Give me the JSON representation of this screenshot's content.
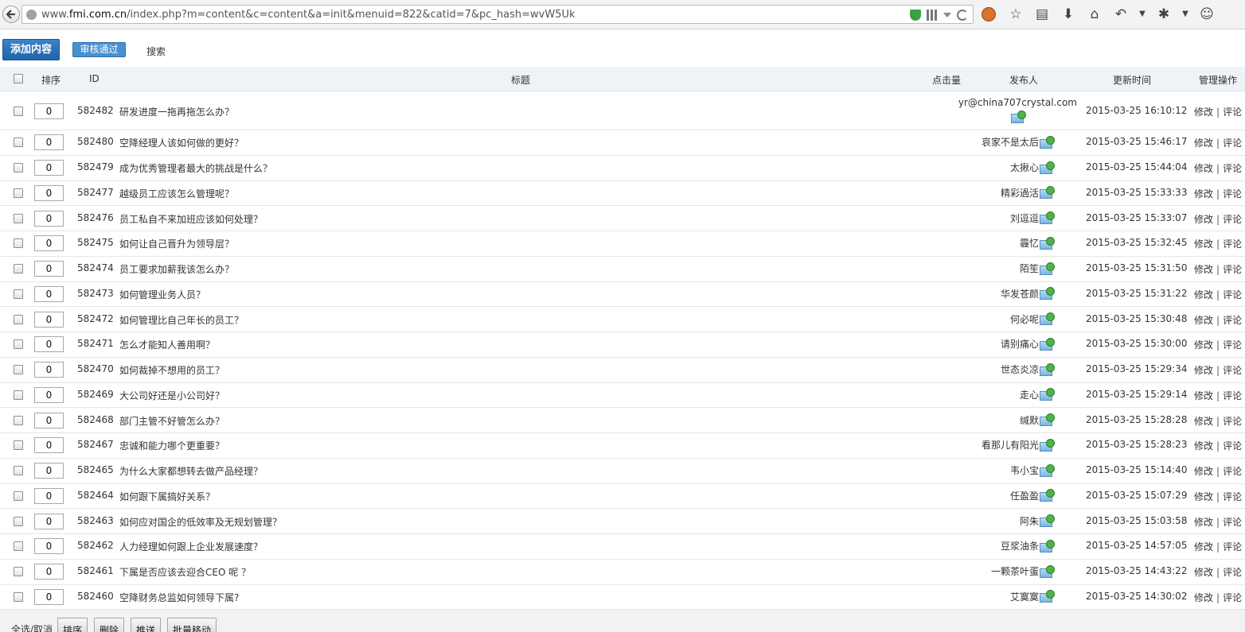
{
  "browser": {
    "url_prefix": "www.",
    "url_domain": "fmi.com.cn",
    "url_path": "/index.php?m=content&c=content&a=init&menuid=822&catid=7&pc_hash=wvW5Uk"
  },
  "toolbar": {
    "add_label": "添加内容",
    "approve_label": "审核通过",
    "search_label": "搜索"
  },
  "table": {
    "headers": {
      "sort": "排序",
      "id": "ID",
      "title": "标题",
      "clicks": "点击量",
      "publisher": "发布人",
      "updated": "更新时间",
      "ops": "管理操作"
    },
    "rows": [
      {
        "sort": "0",
        "id": "582482",
        "title": "研发进度一拖再拖怎么办？",
        "publisher": "yr@china707crystal.com",
        "time": "2015-03-25 16:10:12",
        "edit": "修改",
        "comment": "评论"
      },
      {
        "sort": "0",
        "id": "582480",
        "title": "空降经理人该如何做的更好？",
        "publisher": "哀家不是太后",
        "time": "2015-03-25 15:46:17",
        "edit": "修改",
        "comment": "评论"
      },
      {
        "sort": "0",
        "id": "582479",
        "title": "成为优秀管理者最大的挑战是什么？",
        "publisher": "太揪心",
        "time": "2015-03-25 15:44:04",
        "edit": "修改",
        "comment": "评论"
      },
      {
        "sort": "0",
        "id": "582477",
        "title": "越级员工应该怎么管理呢？",
        "publisher": "精彩過活",
        "time": "2015-03-25 15:33:33",
        "edit": "修改",
        "comment": "评论"
      },
      {
        "sort": "0",
        "id": "582476",
        "title": "员工私自不来加班应该如何处理？",
        "publisher": "刘逗逗",
        "time": "2015-03-25 15:33:07",
        "edit": "修改",
        "comment": "评论"
      },
      {
        "sort": "0",
        "id": "582475",
        "title": "如何让自己晋升为领导层？",
        "publisher": "霾忆",
        "time": "2015-03-25 15:32:45",
        "edit": "修改",
        "comment": "评论"
      },
      {
        "sort": "0",
        "id": "582474",
        "title": "员工要求加薪我该怎么办？",
        "publisher": "陌笙",
        "time": "2015-03-25 15:31:50",
        "edit": "修改",
        "comment": "评论"
      },
      {
        "sort": "0",
        "id": "582473",
        "title": "如何管理业务人员？",
        "publisher": "华发苍颜",
        "time": "2015-03-25 15:31:22",
        "edit": "修改",
        "comment": "评论"
      },
      {
        "sort": "0",
        "id": "582472",
        "title": "如何管理比自己年长的员工？",
        "publisher": "何必呢",
        "time": "2015-03-25 15:30:48",
        "edit": "修改",
        "comment": "评论"
      },
      {
        "sort": "0",
        "id": "582471",
        "title": "怎么才能知人善用啊？",
        "publisher": "请别痛心",
        "time": "2015-03-25 15:30:00",
        "edit": "修改",
        "comment": "评论"
      },
      {
        "sort": "0",
        "id": "582470",
        "title": "如何裁掉不想用的员工？",
        "publisher": "世态炎凉",
        "time": "2015-03-25 15:29:34",
        "edit": "修改",
        "comment": "评论"
      },
      {
        "sort": "0",
        "id": "582469",
        "title": "大公司好还是小公司好？",
        "publisher": "走心",
        "time": "2015-03-25 15:29:14",
        "edit": "修改",
        "comment": "评论"
      },
      {
        "sort": "0",
        "id": "582468",
        "title": "部门主管不好管怎么办？",
        "publisher": "缄默",
        "time": "2015-03-25 15:28:28",
        "edit": "修改",
        "comment": "评论"
      },
      {
        "sort": "0",
        "id": "582467",
        "title": "忠诚和能力哪个更重要？",
        "publisher": "看那儿有阳光",
        "time": "2015-03-25 15:28:23",
        "edit": "修改",
        "comment": "评论"
      },
      {
        "sort": "0",
        "id": "582465",
        "title": "为什么大家都想转去做产品经理？",
        "publisher": "韦小宝",
        "time": "2015-03-25 15:14:40",
        "edit": "修改",
        "comment": "评论"
      },
      {
        "sort": "0",
        "id": "582464",
        "title": "如何跟下属搞好关系？",
        "publisher": "任盈盈",
        "time": "2015-03-25 15:07:29",
        "edit": "修改",
        "comment": "评论"
      },
      {
        "sort": "0",
        "id": "582463",
        "title": "如何应对国企的低效率及无规划管理？",
        "publisher": "阿朱",
        "time": "2015-03-25 15:03:58",
        "edit": "修改",
        "comment": "评论"
      },
      {
        "sort": "0",
        "id": "582462",
        "title": "人力经理如何跟上企业发展速度？",
        "publisher": "豆浆油条",
        "time": "2015-03-25 14:57:05",
        "edit": "修改",
        "comment": "评论"
      },
      {
        "sort": "0",
        "id": "582461",
        "title": "下属是否应该去迎合CEO 呢 ？",
        "publisher": "一颗茶叶蛋",
        "time": "2015-03-25 14:43:22",
        "edit": "修改",
        "comment": "评论"
      },
      {
        "sort": "0",
        "id": "582460",
        "title": "空降财务总监如何领导下属?",
        "publisher": "艾寞寞",
        "time": "2015-03-25 14:30:02",
        "edit": "修改",
        "comment": "评论"
      }
    ]
  },
  "footer": {
    "select_all_label": "全选/取消",
    "buttons": [
      "排序",
      "删除",
      "推送",
      "批量移动"
    ]
  }
}
